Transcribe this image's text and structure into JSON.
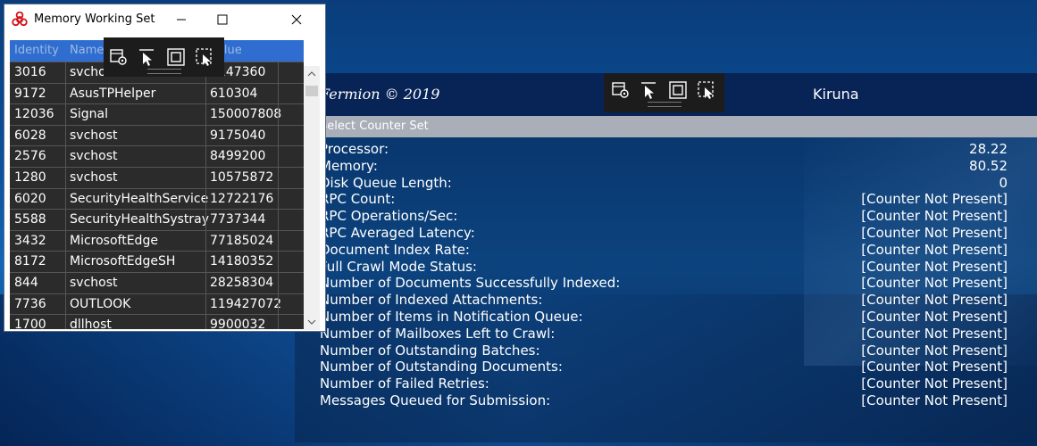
{
  "desktop": {
    "accent": "#0b4f9a"
  },
  "fermion": {
    "brand": "Fermion © 2019",
    "host": "Kiruna",
    "select_counter_set": "Select Counter Set",
    "counters": [
      {
        "label": "Processor:",
        "value": "28.22"
      },
      {
        "label": "Memory:",
        "value": "80.52"
      },
      {
        "label": "Disk Queue Length:",
        "value": "0"
      },
      {
        "label": "RPC Count:",
        "value": "[Counter Not Present]"
      },
      {
        "label": "RPC Operations/Sec:",
        "value": "[Counter Not Present]"
      },
      {
        "label": "RPC Averaged Latency:",
        "value": "[Counter Not Present]"
      },
      {
        "label": "Document Index Rate:",
        "value": "[Counter Not Present]"
      },
      {
        "label": "Full Crawl Mode Status:",
        "value": "[Counter Not Present]"
      },
      {
        "label": "Number of Documents Successfully Indexed:",
        "value": "[Counter Not Present]"
      },
      {
        "label": "Number of Indexed Attachments:",
        "value": "[Counter Not Present]"
      },
      {
        "label": "Number of Items in Notification Queue:",
        "value": "[Counter Not Present]"
      },
      {
        "label": "Number of Mailboxes Left to Crawl:",
        "value": "[Counter Not Present]"
      },
      {
        "label": "Number of Outstanding Batches:",
        "value": "[Counter Not Present]"
      },
      {
        "label": "Number of Outstanding Documents:",
        "value": "[Counter Not Present]"
      },
      {
        "label": "Number of Failed Retries:",
        "value": "[Counter Not Present]"
      },
      {
        "label": "Messages Queued for Submission:",
        "value": "[Counter Not Present]"
      }
    ]
  },
  "toolbar_icons": [
    "settings-cursor-icon",
    "pointer-icon",
    "square-frame-icon",
    "select-region-icon"
  ],
  "memwin": {
    "title": "Memory Working Set",
    "columns": [
      "Identity",
      "Name",
      "Value"
    ],
    "rows": [
      {
        "id": "3016",
        "name": "svchost",
        "value": "3147360"
      },
      {
        "id": "9172",
        "name": "AsusTPHelper",
        "value": "610304"
      },
      {
        "id": "12036",
        "name": "Signal",
        "value": "150007808"
      },
      {
        "id": "6028",
        "name": "svchost",
        "value": "9175040"
      },
      {
        "id": "2576",
        "name": "svchost",
        "value": "8499200"
      },
      {
        "id": "1280",
        "name": "svchost",
        "value": "10575872"
      },
      {
        "id": "6020",
        "name": "SecurityHealthService",
        "value": "12722176"
      },
      {
        "id": "5588",
        "name": "SecurityHealthSystray",
        "value": "7737344"
      },
      {
        "id": "3432",
        "name": "MicrosoftEdge",
        "value": "77185024"
      },
      {
        "id": "8172",
        "name": "MicrosoftEdgeSH",
        "value": "14180352"
      },
      {
        "id": "844",
        "name": "svchost",
        "value": "28258304"
      },
      {
        "id": "7736",
        "name": "OUTLOOK",
        "value": "119427072"
      },
      {
        "id": "1700",
        "name": "dllhost",
        "value": "9900032"
      }
    ]
  }
}
